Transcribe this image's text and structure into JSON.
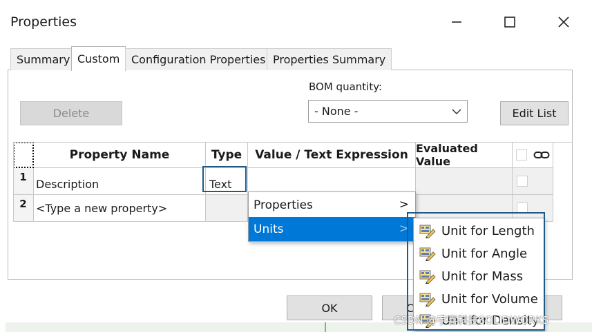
{
  "window": {
    "title": "Properties",
    "minimize_icon": "minimize-icon",
    "maximize_icon": "maximize-icon",
    "close_icon": "close-icon"
  },
  "tabs": [
    {
      "label": "Summary",
      "active": false
    },
    {
      "label": "Custom",
      "active": true
    },
    {
      "label": "Configuration Properties",
      "active": false
    },
    {
      "label": "Properties Summary",
      "active": false
    }
  ],
  "toolbar": {
    "delete_label": "Delete",
    "bom_label": "BOM quantity:",
    "bom_value": "- None -",
    "edit_list_label": "Edit List"
  },
  "table": {
    "headers": {
      "property_name": "Property Name",
      "type": "Type",
      "value": "Value / Text Expression",
      "evaluated": "Evaluated Value",
      "link_icon": "link-icon"
    },
    "rows": [
      {
        "num": "1",
        "name": "Description",
        "type": "Text",
        "value": "",
        "evaluated": ""
      },
      {
        "num": "2",
        "name": "<Type a new property>",
        "type": "",
        "value": "",
        "evaluated": ""
      }
    ]
  },
  "context_menu": {
    "items": [
      {
        "label": "Properties",
        "arrow": ">"
      },
      {
        "label": "Units",
        "arrow": ">"
      }
    ]
  },
  "units_submenu": {
    "icon": "unit-icon",
    "items": [
      {
        "label": "Unit for Length"
      },
      {
        "label": "Unit for Angle"
      },
      {
        "label": "Unit for Mass"
      },
      {
        "label": "Unit for Volume"
      },
      {
        "label": "Unit for Density"
      }
    ]
  },
  "footer": {
    "ok_label": "OK",
    "cancel_label_partial": "C"
  },
  "watermark": "CSDN @宇喜科技SOLIDWORKS",
  "colors": {
    "selection_blue": "#0078d7",
    "highlight_border": "#1c5a8a"
  }
}
